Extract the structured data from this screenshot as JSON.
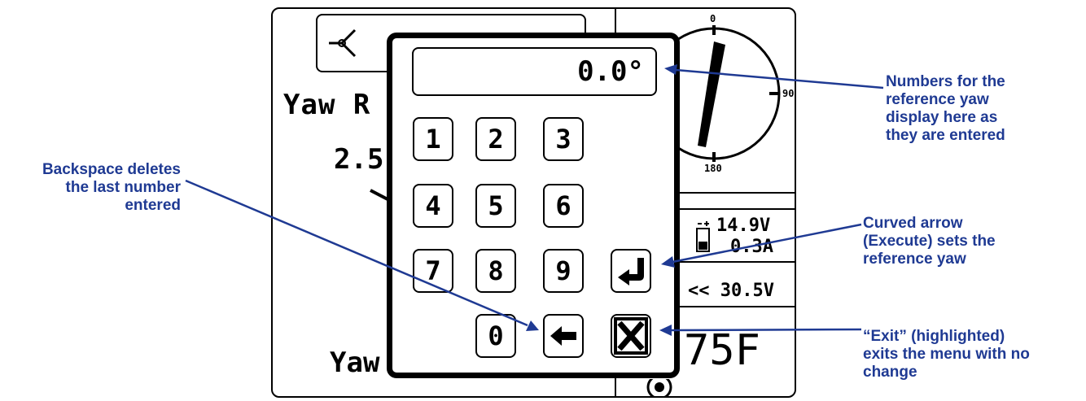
{
  "background": {
    "yaw_title": "Yaw R",
    "yaw_value": "2.5",
    "yaw_bottom": "Yaw",
    "compass_labels": [
      "0",
      "90",
      "180"
    ],
    "battery_voltage": "14.9V",
    "battery_current": "0.3A",
    "supply_voltage": "<< 30.5V",
    "temperature": "75F"
  },
  "keypad": {
    "display_value": "0.0°",
    "keys": [
      "1",
      "2",
      "3",
      "4",
      "5",
      "6",
      "7",
      "8",
      "9",
      "0"
    ],
    "enter_icon": "return-arrow-icon",
    "backspace_icon": "left-arrow-icon",
    "exit_icon": "x-box-icon"
  },
  "annotations": {
    "display_note": [
      "Numbers for the",
      "reference yaw",
      "display here as",
      "they are entered"
    ],
    "backspace_note": [
      "Backspace deletes",
      "the last number",
      "entered"
    ],
    "enter_note": [
      "Curved arrow",
      "(Execute) sets the",
      "reference yaw"
    ],
    "exit_note": [
      "“Exit” (highlighted)",
      "exits the menu with no",
      "change"
    ]
  },
  "colors": {
    "annotation": "#1f3a93",
    "lcd": "#000000"
  }
}
